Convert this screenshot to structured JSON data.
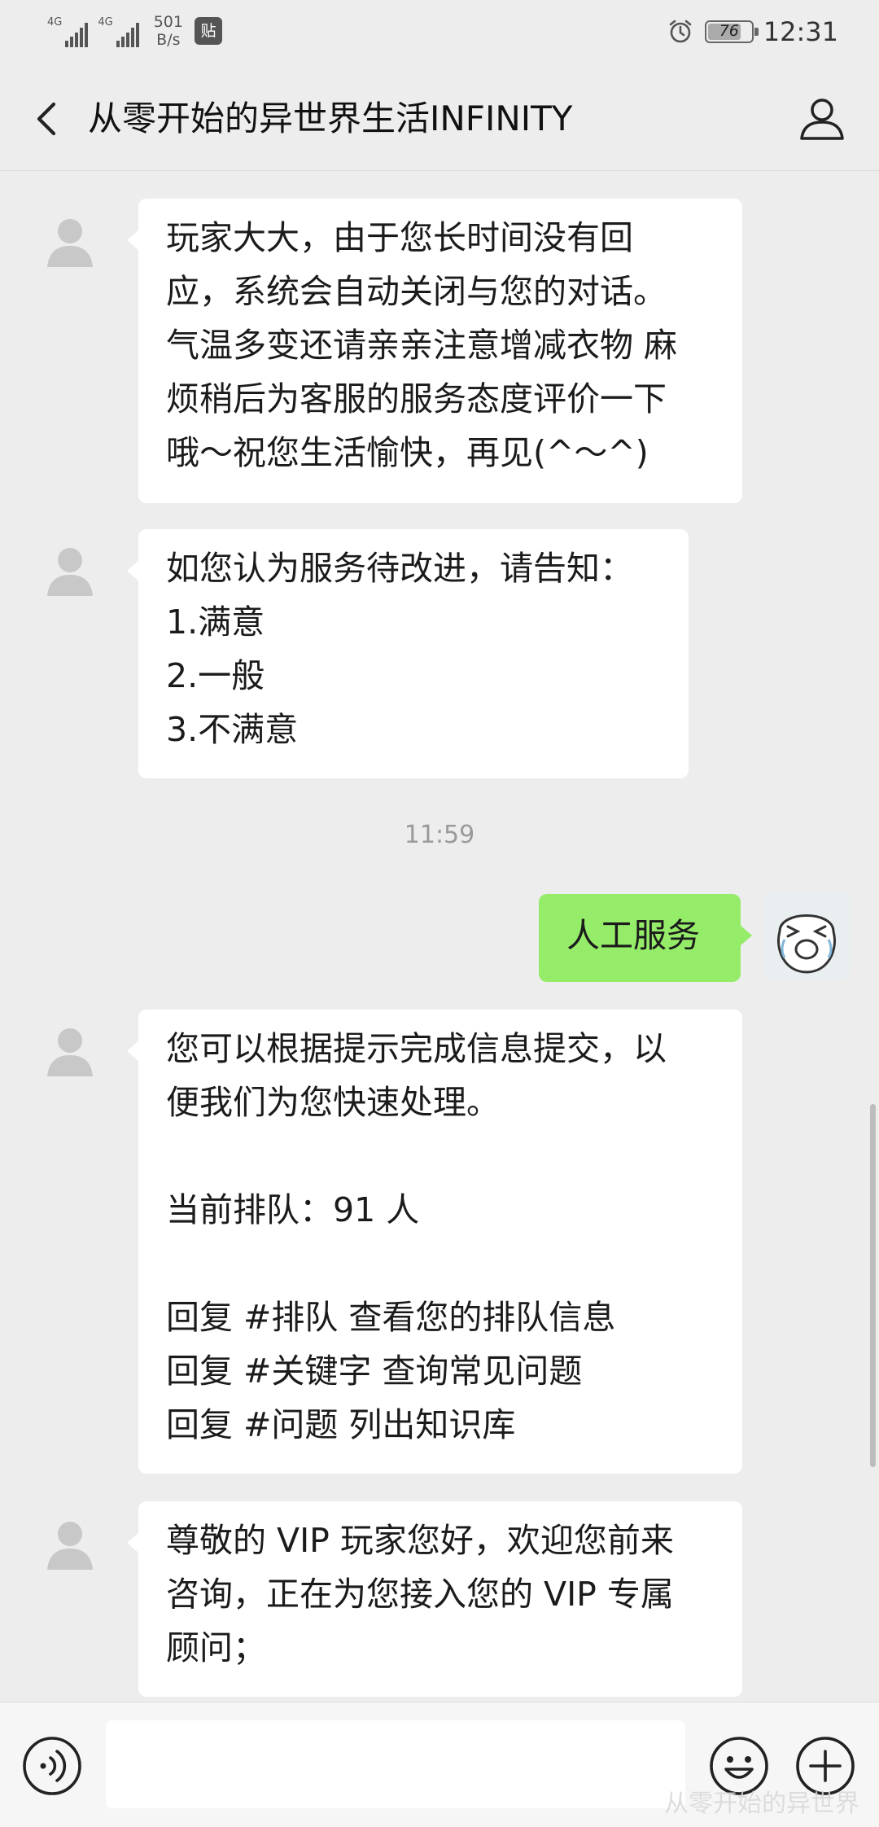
{
  "status_bar": {
    "signal1_label": "4G",
    "signal2_label": "4G",
    "net_speed_value": "501",
    "net_speed_unit": "B/s",
    "tie_icon_text": "贴",
    "battery_level": "76",
    "time": "12:31"
  },
  "header": {
    "title": "从零开始的异世界生活INFINITY"
  },
  "messages": [
    {
      "direction": "incoming",
      "text": "玩家大大，由于您长时间没有回\n应，系统会自动关闭与您的对话。\n气温多变还请亲亲注意增减衣物 麻\n烦稍后为客服的服务态度评价一下\n哦～祝您生活愉快，再见(^～^)"
    },
    {
      "direction": "incoming",
      "text": "如您认为服务待改进，请告知：\n1.满意\n2.一般\n3.不满意"
    },
    {
      "direction": "outgoing",
      "text": "人工服务"
    },
    {
      "direction": "incoming",
      "text": "您可以根据提示完成信息提交，以\n便我们为您快速处理。\n\n当前排队：91 人\n\n回复 #排队 查看您的排队信息\n回复 #关键字 查询常见问题\n回复 #问题 列出知识库"
    },
    {
      "direction": "incoming",
      "text": "尊敬的 VIP 玩家您好，欢迎您前来\n咨询，正在为您接入您的 VIP 专属\n顾问；"
    }
  ],
  "timestamp": "11:59",
  "input_bar": {
    "input_value": ""
  },
  "watermark": "从零开始的异世界",
  "colors": {
    "background": "#ededed",
    "incoming_bubble": "#ffffff",
    "outgoing_bubble": "#95ec69",
    "timestamp_text": "#9a9a9a"
  }
}
